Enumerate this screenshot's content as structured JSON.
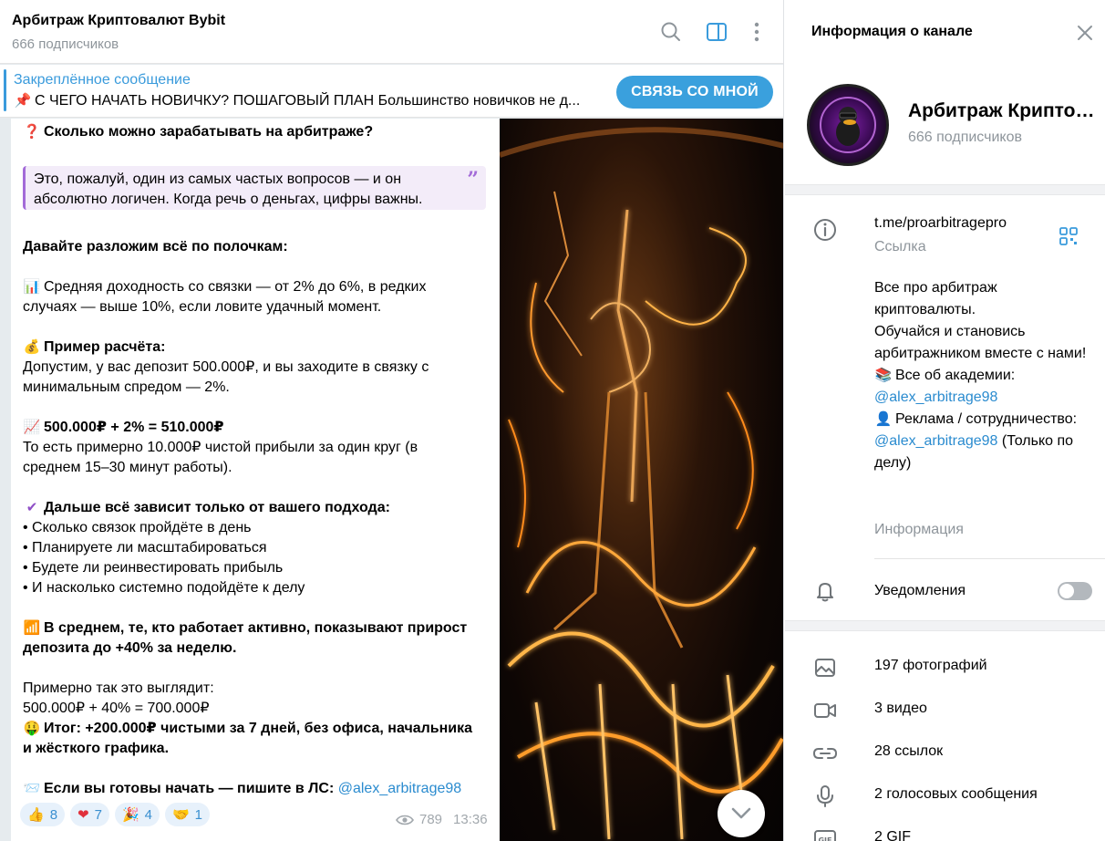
{
  "chat": {
    "title": "Арбитраж Криптовалют Bybit",
    "subtitle": "666 подписчиков",
    "pinned": {
      "label": "Закреплённое сообщение",
      "text": "С ЧЕГО НАЧАТЬ НОВИЧКУ? ПОШАГОВЫЙ ПЛАН  Большинство новичков не д...",
      "button": "СВЯЗЬ СО МНОЙ"
    },
    "message": {
      "q_title": "Сколько можно зарабатывать на арбитраже?",
      "quote_line1": "Это, пожалуй, один из самых частых вопросов — и он",
      "quote_line2": "абсолютно логичен. Когда речь о деньгах, цифры важны.",
      "heading": "Давайте разложим всё по полочкам:",
      "avg_line1": "Средняя доходность со связки — от 2% до 6%, в редких",
      "avg_line2": "случаях — выше 10%, если ловите удачный момент.",
      "calc_title": "Пример расчёта:",
      "calc_line1": "Допустим, у вас депозит 500.000₽, и вы заходите в связку с",
      "calc_line2": "минимальным спредом — 2%.",
      "formula1": "500.000₽ + 2% = 510.000₽",
      "profit_line1": "То есть примерно 10.000₽ чистой прибыли за один круг (в",
      "profit_line2": "среднем 15–30 минут работы).",
      "depends_title": "Дальше всё зависит только от вашего подхода:",
      "bullets": [
        "• Сколько связок пройдёте в день",
        "• Планируете ли масштабироваться",
        "• Будете ли реинвестировать прибыль",
        "• И насколько системно подойдёте к делу"
      ],
      "avg_active1": "В среднем, те, кто работает активно, показывают прирост",
      "avg_active2": "депозита до +40% за неделю.",
      "approx": "Примерно так это выглядит:",
      "formula2": "500.000₽ + 40% = 700.000₽",
      "result1": "Итог: +200.000₽ чистыми за 7 дней, без офиса, начальника",
      "result2": "и жёсткого графика.",
      "cta": "Если вы готовы начать — пишите в ЛС: ",
      "cta_link": "@alex_arbitrage98"
    },
    "reactions": [
      {
        "emoji": "👍",
        "count": "8"
      },
      {
        "emoji": "❤",
        "count": "7"
      },
      {
        "emoji": "🎉",
        "count": "4"
      },
      {
        "emoji": "🤝",
        "count": "1"
      }
    ],
    "views": "789",
    "time": "13:36"
  },
  "panel": {
    "title": "Информация о канале",
    "channel_name": "Арбитраж Крипто…",
    "subscribers": "666 подписчиков",
    "link": "t.me/proarbitragepro",
    "link_label": "Ссылка",
    "about": {
      "line1": "Все про арбитраж криптовалюты.",
      "line2": "Обучайся и становись арбитражником вместе с нами!",
      "academy": "Все об академии:",
      "academy_link": "@alex_arbitrage98",
      "ads": "Реклама / сотрудничество:",
      "ads_link": "@alex_arbitrage98",
      "ads_note": " (Только по делу)"
    },
    "info_label": "Информация",
    "notifications": "Уведомления",
    "media": {
      "photos": "197 фотографий",
      "videos": "3 видео",
      "links": "28 ссылок",
      "voice": "2 голосовых сообщения",
      "gif": "2 GIF"
    }
  },
  "colors": {
    "accent": "#3a9bdc",
    "quote_border": "#a36bd8",
    "button": "#3aa0dd"
  }
}
